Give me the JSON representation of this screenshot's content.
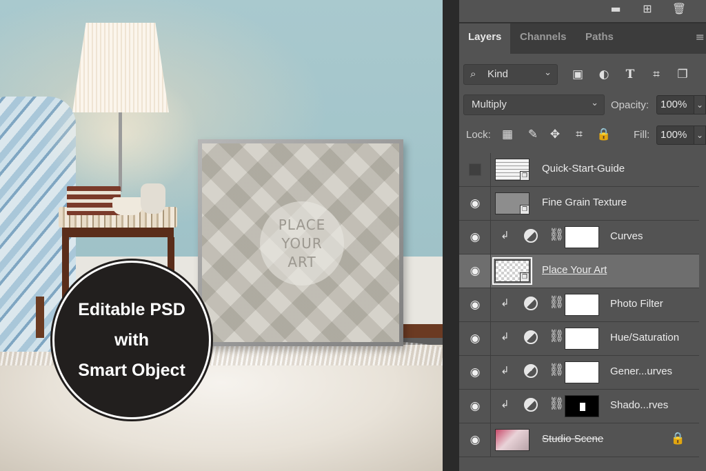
{
  "photo": {
    "frame_text": "PLACE\nYOUR\nART",
    "badge_lines": [
      "Editable PSD",
      "with",
      "Smart Object"
    ]
  },
  "panel": {
    "top_icons": [
      "folder-icon",
      "new-layer-icon",
      "trash-icon"
    ],
    "tabs": [
      {
        "label": "Layers",
        "active": true
      },
      {
        "label": "Channels",
        "active": false
      },
      {
        "label": "Paths",
        "active": false
      }
    ],
    "filter": {
      "kind_label": "Kind",
      "icons": [
        "image-filter-icon",
        "adjustment-filter-icon",
        "type-filter-icon",
        "shape-filter-icon",
        "smart-object-filter-icon"
      ]
    },
    "blend_mode": "Multiply",
    "opacity_label": "Opacity:",
    "opacity_value": "100%",
    "lock_label": "Lock:",
    "lock_icons": [
      "lock-transparent-icon",
      "lock-image-icon",
      "lock-position-icon",
      "lock-artboard-icon",
      "lock-all-icon"
    ],
    "fill_label": "Fill:",
    "fill_value": "100%",
    "layers": [
      {
        "name": "Quick-Start-Guide",
        "type": "smart",
        "visible": false
      },
      {
        "name": "Fine Grain Texture",
        "type": "smart",
        "visible": true
      },
      {
        "name": "Curves",
        "type": "adjustment",
        "visible": true
      },
      {
        "name": "Place Your Art",
        "type": "smart",
        "visible": true,
        "selected": true
      },
      {
        "name": "Photo Filter",
        "type": "adjustment",
        "visible": true
      },
      {
        "name": "Hue/Saturation",
        "type": "adjustment",
        "visible": true
      },
      {
        "name": "Gener...urves",
        "type": "adjustment",
        "visible": true
      },
      {
        "name": "Shado...rves",
        "type": "adjustment",
        "visible": true
      },
      {
        "name": "Studio Scene",
        "type": "smart",
        "visible": true,
        "locked": true
      }
    ]
  }
}
